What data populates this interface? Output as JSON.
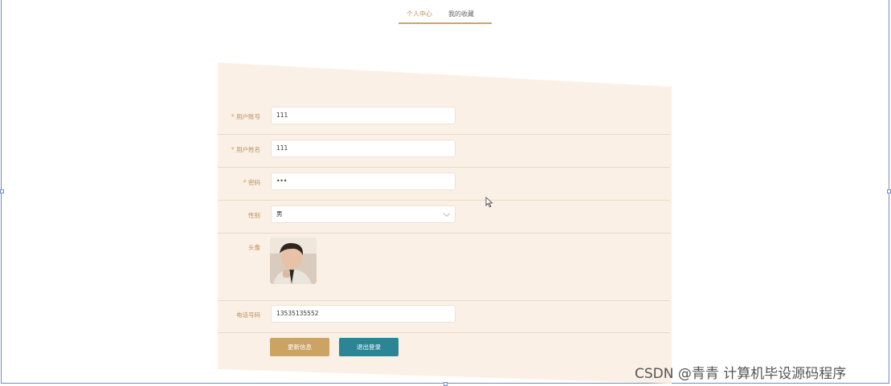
{
  "tabs": [
    {
      "label": "个人中心",
      "active": true
    },
    {
      "label": "我的收藏",
      "active": false
    }
  ],
  "form": {
    "account": {
      "label": "用户账号",
      "required": "*",
      "value": "111"
    },
    "name": {
      "label": "用户姓名",
      "required": "*",
      "value": "111"
    },
    "password": {
      "label": "密码",
      "required": "*",
      "value": "•••"
    },
    "gender": {
      "label": "性别",
      "value": "男"
    },
    "avatar": {
      "label": "头像"
    },
    "phone": {
      "label": "电话号码",
      "value": "13535135552"
    }
  },
  "buttons": {
    "update": "更新信息",
    "logout": "退出登录"
  },
  "watermark": "CSDN @青青  计算机毕设源码程序",
  "colors": {
    "accent": "#cda364",
    "panel": "#fbf0e5",
    "logout": "#2b8597",
    "label": "#b88f5a"
  },
  "icons": {
    "gender_select": "chevron-down-icon",
    "cursor": "mouse-pointer-icon"
  }
}
